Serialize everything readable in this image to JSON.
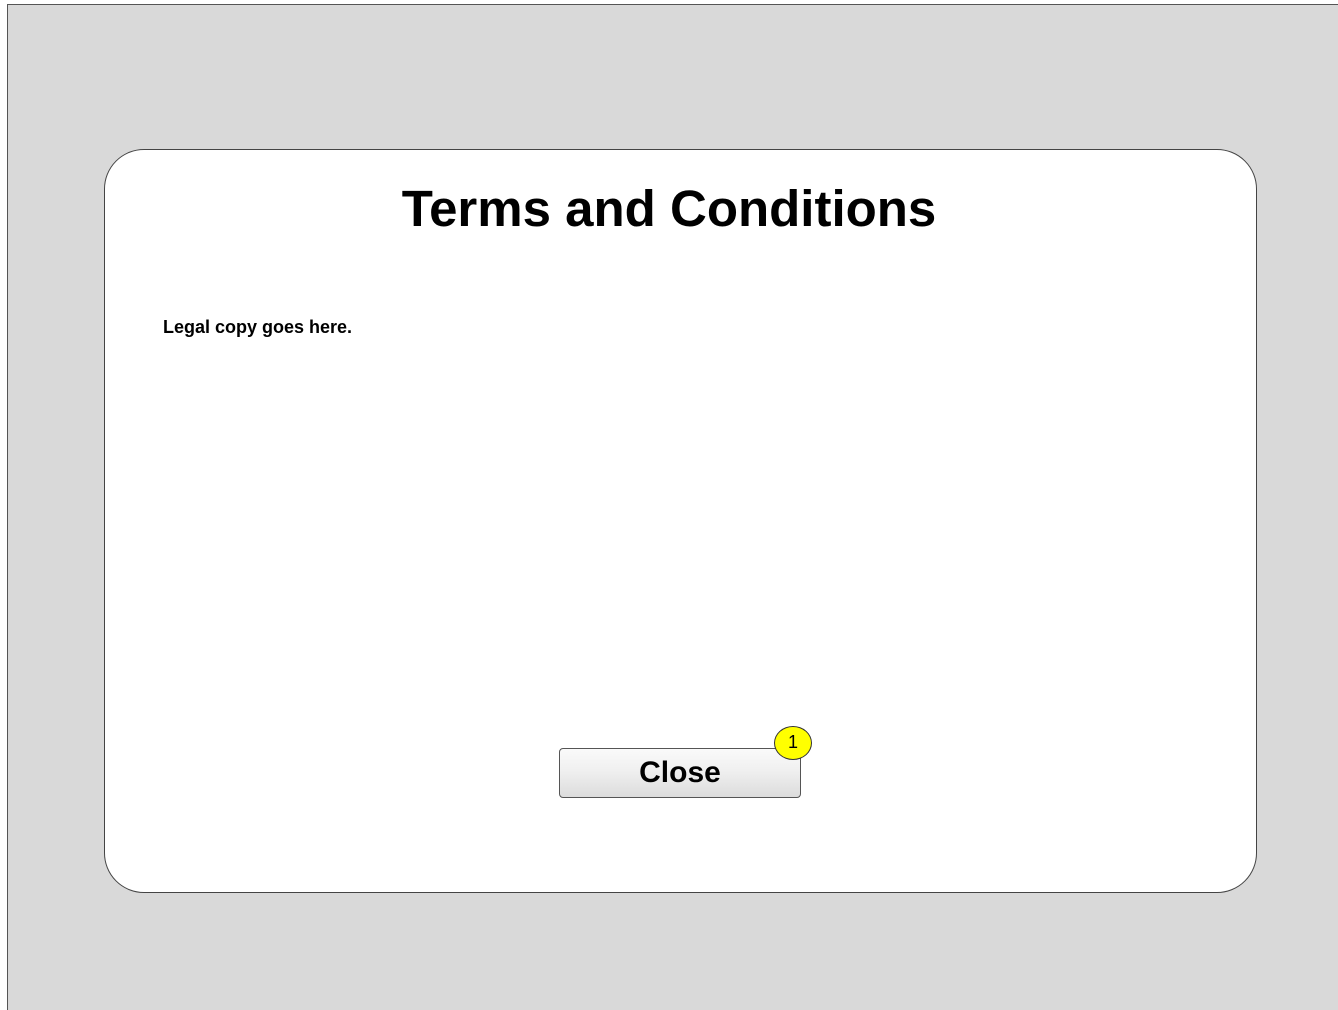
{
  "dialog": {
    "title": "Terms and Conditions",
    "body_text": "Legal copy goes here.",
    "close_label": "Close"
  },
  "annotation": {
    "badge_number": "1",
    "badge_color": "#ffff00"
  },
  "colors": {
    "backdrop": "#d9d9d9",
    "dialog_background": "#ffffff"
  }
}
